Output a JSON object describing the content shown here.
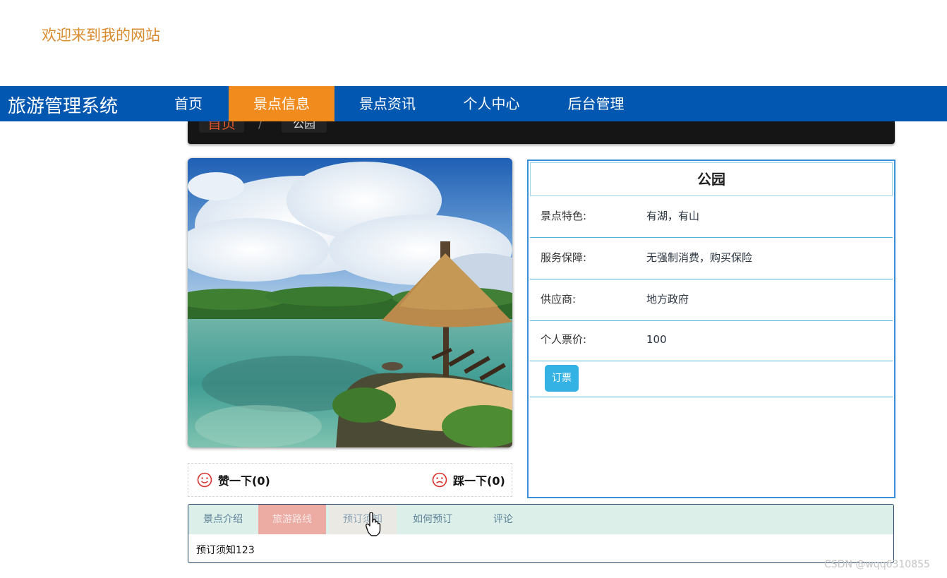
{
  "header": {
    "welcome_text": "欢迎来到我的网站"
  },
  "navbar": {
    "brand": "旅游管理系统",
    "items": [
      {
        "label": "首页",
        "active": false
      },
      {
        "label": "景点信息",
        "active": true
      },
      {
        "label": "景点资讯",
        "active": false
      },
      {
        "label": "个人中心",
        "active": false
      },
      {
        "label": "后台管理",
        "active": false
      }
    ],
    "colors": {
      "bar": "#0257b1",
      "active": "#f28b1d"
    }
  },
  "breadcrumb": {
    "home": "首页",
    "separator": "/",
    "current": "公园"
  },
  "attraction": {
    "name": "公园",
    "rows": [
      {
        "label": "景点特色:",
        "value": "有湖，有山"
      },
      {
        "label": "服务保障:",
        "value": "无强制消费，购买保险"
      },
      {
        "label": "供应商:",
        "value": "地方政府"
      },
      {
        "label": "个人票价:",
        "value": "100"
      }
    ],
    "book_button": "订票"
  },
  "votes": {
    "like_label": "赞一下(0)",
    "dislike_label": "踩一下(0)",
    "like_icon": "smile-icon",
    "dislike_icon": "frown-icon"
  },
  "tabs": {
    "items": [
      {
        "label": "景点介绍"
      },
      {
        "label": "旅游路线"
      },
      {
        "label": "预订须知"
      },
      {
        "label": "如何预订"
      },
      {
        "label": "评论"
      }
    ],
    "content": "预订须知123"
  },
  "watermark": "CSDN @wqq6310855"
}
